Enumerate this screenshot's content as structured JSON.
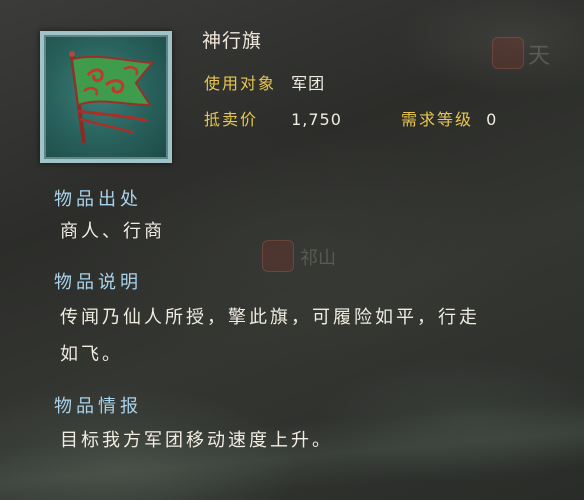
{
  "item": {
    "name": "神行旗",
    "target_label": "使用对象",
    "target_value": "军团",
    "price_label": "抵卖价",
    "price_value": "1,750",
    "level_label": "需求等级",
    "level_value": "0",
    "icon": "green-war-banner-icon"
  },
  "sections": {
    "source_title": "物品出处",
    "source_body": "商人、行商",
    "desc_title": "物品说明",
    "desc_line1": "传闻乃仙人所授，擎此旗，可履险如平，行走",
    "desc_line2": "如飞。",
    "info_title": "物品情报",
    "info_body": "目标我方军团移动速度上升。"
  },
  "background": {
    "label_a": "天",
    "label_b": "祁山"
  },
  "colors": {
    "label_gold": "#e7c64f",
    "section_blue": "#a9d3eb",
    "text_white": "#f1ece2",
    "frame_teal": "#9fc3c6"
  }
}
